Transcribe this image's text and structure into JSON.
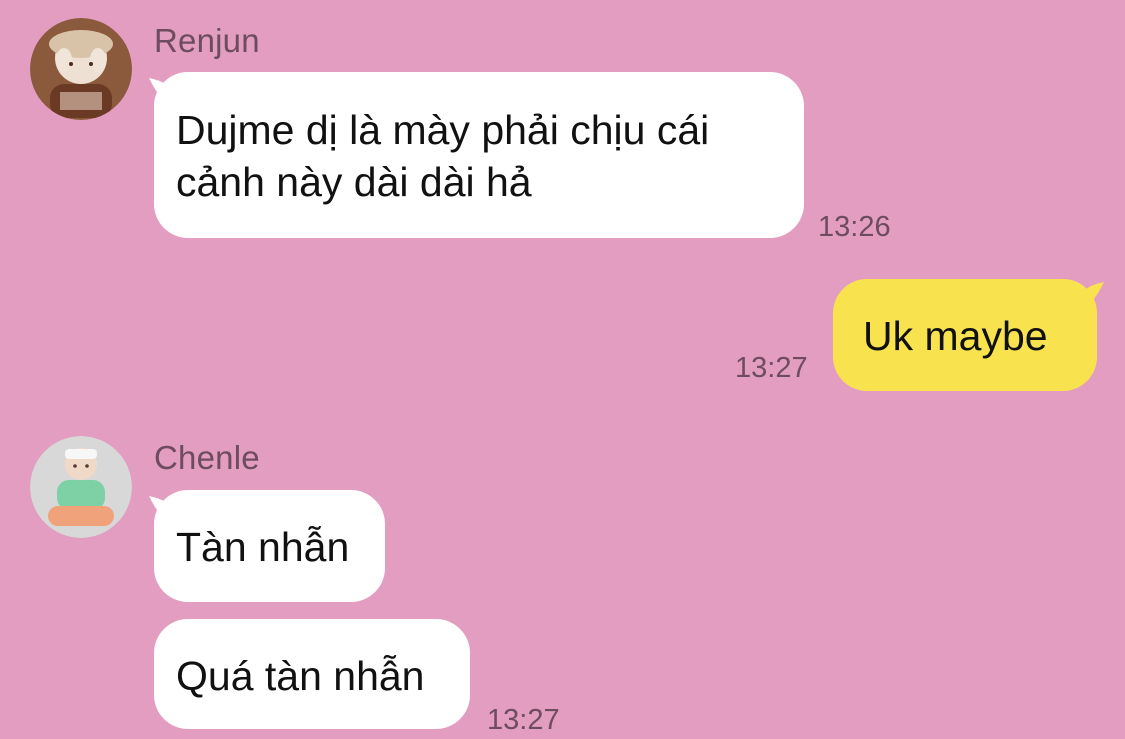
{
  "messages": {
    "renjun": {
      "sender": "Renjun",
      "text_line1": "Dujme dị là mày phải chịu cái",
      "text_line2": "cảnh này dài dài hả",
      "time": "13:26"
    },
    "self": {
      "text": "Uk maybe",
      "time": "13:27"
    },
    "chenle": {
      "sender": "Chenle",
      "text1": "Tàn nhẫn",
      "text2": "Quá tàn nhẫn",
      "time": "13:27"
    }
  },
  "colors": {
    "background": "#e39dc0",
    "incoming_bubble": "#ffffff",
    "outgoing_bubble": "#f8e34f",
    "meta_text": "#6e4c60"
  },
  "icons": {
    "renjun_avatar": "avatar-image",
    "chenle_avatar": "avatar-image"
  }
}
